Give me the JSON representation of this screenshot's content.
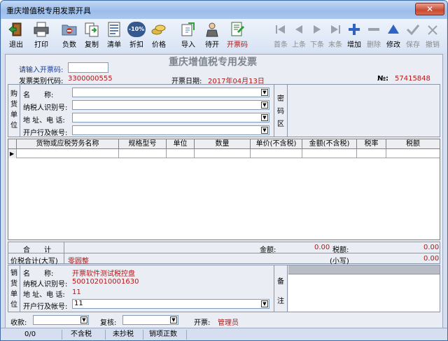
{
  "window": {
    "title": "重庆增值税专用发票开具"
  },
  "toolbar": {
    "left": [
      {
        "label": "退出",
        "icon": "exit-door-icon"
      },
      {
        "label": "打印",
        "icon": "printer-icon"
      },
      {
        "label": "负数",
        "icon": "folder-icon"
      },
      {
        "label": "复制",
        "icon": "copy-icon"
      },
      {
        "label": "清单",
        "icon": "list-icon"
      },
      {
        "label": "折扣",
        "icon": "discount-badge-icon",
        "badge": "-10%"
      },
      {
        "label": "价格",
        "icon": "coins-icon"
      },
      {
        "label": "导入",
        "icon": "import-icon"
      },
      {
        "label": "待开",
        "icon": "pending-icon"
      },
      {
        "label": "开票码",
        "icon": "invoice-code-icon"
      }
    ],
    "right": [
      {
        "label": "首条",
        "icon": "first-record-icon",
        "disabled": true
      },
      {
        "label": "上条",
        "icon": "prev-record-icon",
        "disabled": true
      },
      {
        "label": "下条",
        "icon": "next-record-icon",
        "disabled": true
      },
      {
        "label": "末条",
        "icon": "last-record-icon",
        "disabled": true
      },
      {
        "label": "增加",
        "icon": "plus-icon",
        "disabled": false
      },
      {
        "label": "删除",
        "icon": "minus-icon",
        "disabled": true
      },
      {
        "label": "修改",
        "icon": "modify-icon",
        "disabled": false
      },
      {
        "label": "保存",
        "icon": "check-icon",
        "disabled": true
      },
      {
        "label": "撤销",
        "icon": "undo-icon",
        "disabled": true
      }
    ]
  },
  "invoice": {
    "title": "重庆增值税专用发票",
    "input_code_label": "请输入开票码:",
    "type_code_label": "发票类别代码:",
    "type_code_value": "3300000555",
    "date_label": "开票日期:",
    "date_value": "2017年04月13日",
    "number_label": "№:",
    "number_value": "57415848"
  },
  "buyer": {
    "side_label": [
      "购",
      "货",
      "单",
      "位"
    ],
    "fields": [
      {
        "label": "名　　称:",
        "value": ""
      },
      {
        "label": "纳税人识别号:",
        "value": ""
      },
      {
        "label": "地 址、电 话:",
        "value": ""
      },
      {
        "label": "开户行及帐号:",
        "value": ""
      }
    ],
    "cipher_label": [
      "密",
      "码",
      "区"
    ]
  },
  "goods_table": {
    "columns": [
      "货物或应税劳务名称",
      "规格型号",
      "单位",
      "数量",
      "单价(不含税)",
      "金额(不含税)",
      "税率",
      "税额"
    ]
  },
  "totals": {
    "total_label": "合　　计",
    "amount_label": "金额:",
    "amount_value": "0.00",
    "tax_label": "税额:",
    "tax_value": "0.00",
    "price_tax_label": "价税合计(大写)",
    "price_tax_upper": "零圆整",
    "lower_label": "(小写)",
    "lower_value": "0.00"
  },
  "seller": {
    "side_label": [
      "销",
      "货",
      "单",
      "位"
    ],
    "name_label": "名　　称:",
    "name_value": "开票软件测试税控盘",
    "tax_id_label": "纳税人识别号:",
    "tax_id_value": "500102010001630",
    "addr_label": "地 址、电 话:",
    "addr_value": "11",
    "bank_label": "开户行及帐号:",
    "bank_value": "11",
    "remark_label": [
      "备",
      "注"
    ]
  },
  "footer": {
    "payee_label": "收款:",
    "payee_value": "",
    "reviewer_label": "复核:",
    "reviewer_value": "",
    "drawer_label": "开票:",
    "drawer_value": "管理员"
  },
  "status_bar": [
    "0/0",
    "不含税",
    "未抄税",
    "销项正数"
  ],
  "colors": {
    "accent_red": "#b01818",
    "accent_blue": "#143c9a",
    "window_bg": "#d6dfef"
  }
}
